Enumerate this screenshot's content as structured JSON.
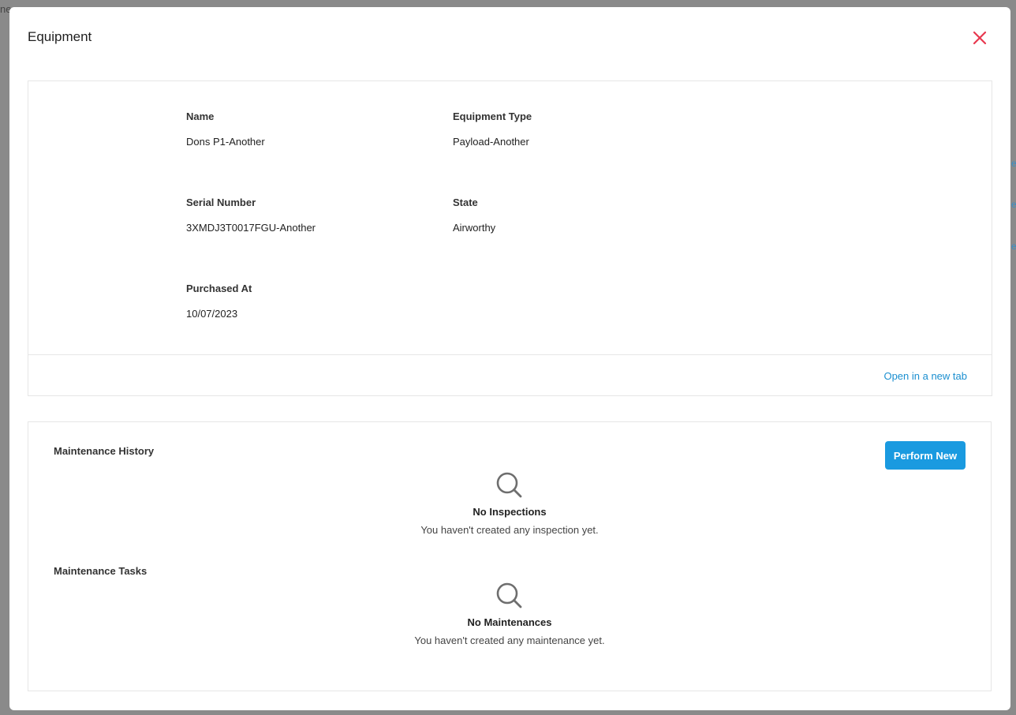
{
  "background": {
    "corner_text": "ne"
  },
  "modal": {
    "title": "Equipment",
    "close_icon": "close-icon"
  },
  "details": {
    "fields": {
      "name": {
        "label": "Name",
        "value": "Dons P1-Another"
      },
      "equipment_type": {
        "label": "Equipment Type",
        "value": "Payload-Another"
      },
      "serial_number": {
        "label": "Serial Number",
        "value": "3XMDJ3T0017FGU-Another"
      },
      "state": {
        "label": "State",
        "value": "Airworthy"
      },
      "purchased_at": {
        "label": "Purchased At",
        "value": "10/07/2023"
      }
    },
    "open_link": "Open in a new tab"
  },
  "maintenance": {
    "history_title": "Maintenance History",
    "perform_button": "Perform New",
    "inspections_empty": {
      "icon": "search-icon",
      "title": "No Inspections",
      "description": "You haven't created any inspection yet."
    },
    "tasks_title": "Maintenance Tasks",
    "maintenances_empty": {
      "icon": "search-icon",
      "title": "No Maintenances",
      "description": "You haven't created any maintenance yet."
    }
  },
  "colors": {
    "close": "#e8384f",
    "link": "#1b8fd0",
    "primary_button": "#1a9ae0",
    "backdrop": "#8a8a8a"
  }
}
